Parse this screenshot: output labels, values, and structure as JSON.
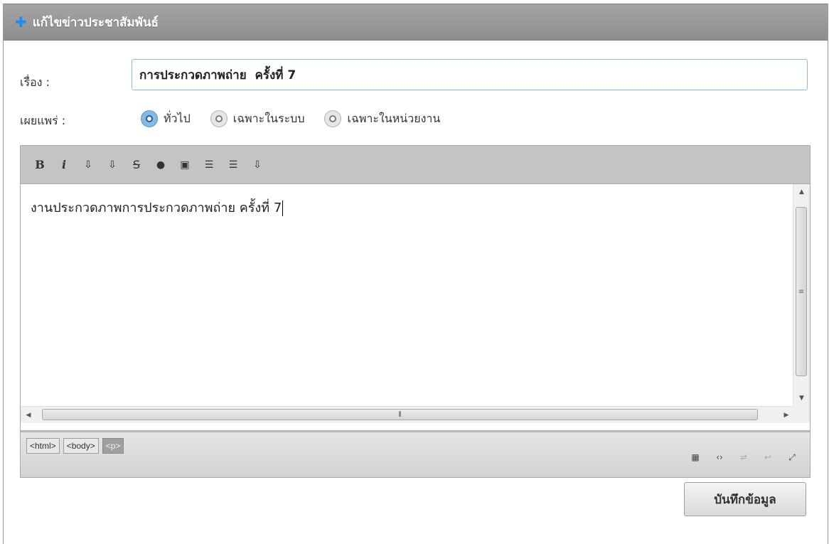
{
  "header": {
    "icon": "plus-icon",
    "title": "แก้ไขข่าวประชาสัมพันธ์"
  },
  "form": {
    "subject_label": "เรื่อง :",
    "subject_value": "การประกวดภาพถ่าย  ครั้งที่ 7",
    "publish_label": "เผยแพร่ :",
    "publish_options": [
      {
        "label": "ทั่วไป",
        "checked": true
      },
      {
        "label": "เฉพาะในระบบ",
        "checked": false
      },
      {
        "label": "เฉพาะในหน่วยงาน",
        "checked": false
      }
    ]
  },
  "editor": {
    "toolbar": [
      {
        "name": "bold-button",
        "glyph": "B"
      },
      {
        "name": "italic-button",
        "glyph": "i"
      },
      {
        "name": "format-button-1",
        "glyph": "⇩"
      },
      {
        "name": "format-button-2",
        "glyph": "⇩"
      },
      {
        "name": "strikethrough-button",
        "glyph": "S"
      },
      {
        "name": "color-button",
        "glyph": "●"
      },
      {
        "name": "image-button",
        "glyph": "▣"
      },
      {
        "name": "ordered-list-button",
        "glyph": "☰"
      },
      {
        "name": "unordered-list-button",
        "glyph": "☰"
      },
      {
        "name": "format-button-3",
        "glyph": "⇩"
      }
    ],
    "content": "งานประกวดภาพการประกวดภาพถ่าย  ครั้งที่ 7",
    "path": [
      "<html>",
      "<body>",
      "<p>"
    ],
    "status_icons": [
      {
        "name": "table-icon",
        "glyph": "▦"
      },
      {
        "name": "code-icon",
        "glyph": "‹›"
      },
      {
        "name": "format-icon",
        "glyph": "⇌"
      },
      {
        "name": "wrap-icon",
        "glyph": "↩"
      },
      {
        "name": "fullscreen-icon",
        "glyph": "⤢"
      }
    ]
  },
  "actions": {
    "save_label": "บันทึกข้อมูล"
  },
  "colors": {
    "header_bg": "#9a9a9a",
    "accent": "#1d8ef0",
    "radio_checked": "#86b9e0"
  }
}
